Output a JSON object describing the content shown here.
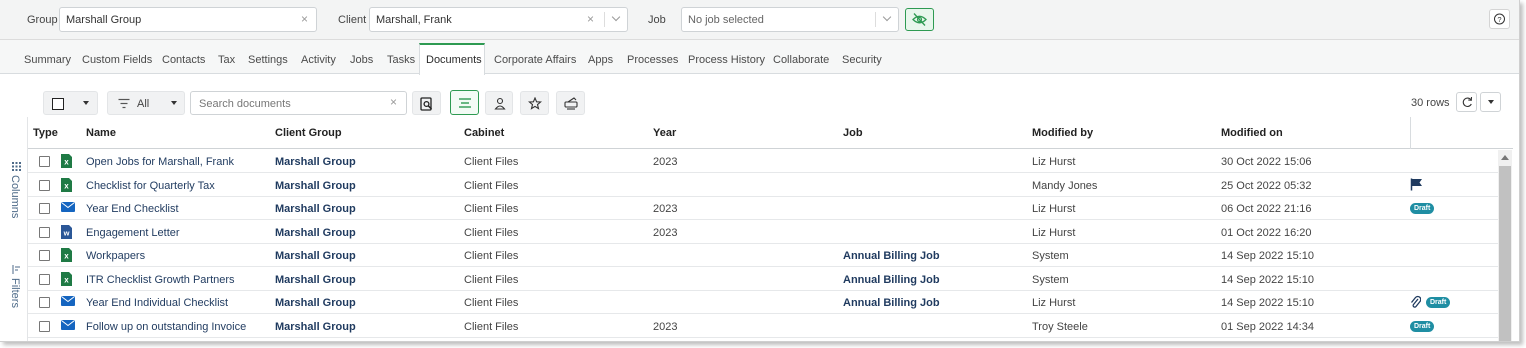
{
  "colors": {
    "accent": "#2e9a52",
    "link": "#1f3a5f",
    "badge": "#1f8ea3",
    "excel": "#1f7a45",
    "word": "#2b5797",
    "mail": "#1565c0"
  },
  "filters": {
    "group_label": "Group",
    "group_value": "Marshall Group",
    "client_label": "Client",
    "client_value": "Marshall, Frank",
    "job_label": "Job",
    "job_placeholder": "No job selected",
    "clear_glyph": "×",
    "help_glyph": "?"
  },
  "tabs": [
    "Summary",
    "Custom Fields",
    "Contacts",
    "Tax",
    "Settings",
    "Activity",
    "Jobs",
    "Tasks",
    "Documents",
    "Corporate Affairs",
    "Apps",
    "Processes",
    "Process History",
    "Collaborate",
    "Security"
  ],
  "active_tab": "Documents",
  "toolbar": {
    "filter_label": "All",
    "search_placeholder": "Search documents",
    "rows_count": "30 rows"
  },
  "rail": {
    "columns_label": "Columns",
    "filters_label": "Filters"
  },
  "table": {
    "headers": [
      "Type",
      "Name",
      "Client Group",
      "Cabinet",
      "Year",
      "Job",
      "Modified by",
      "Modified on"
    ],
    "rows": [
      {
        "type": "excel-icon",
        "name": "Open Jobs for Marshall, Frank",
        "client_group": "Marshall Group",
        "cabinet": "Client Files",
        "year": "2023",
        "job": "",
        "modified_by": "Liz Hurst",
        "modified_on": "30 Oct 2022 15:06",
        "flags": []
      },
      {
        "type": "excel-icon",
        "name": "Checklist for Quarterly Tax",
        "client_group": "Marshall Group",
        "cabinet": "Client Files",
        "year": "",
        "job": "",
        "modified_by": "Mandy Jones",
        "modified_on": "25 Oct 2022 05:32",
        "flags": [
          "flag-icon"
        ]
      },
      {
        "type": "mail-icon",
        "name": "Year End Checklist",
        "client_group": "Marshall Group",
        "cabinet": "Client Files",
        "year": "2023",
        "job": "",
        "modified_by": "Liz Hurst",
        "modified_on": "06 Oct 2022 21:16",
        "flags": [
          "Draft"
        ]
      },
      {
        "type": "word-icon",
        "name": "Engagement Letter",
        "client_group": "Marshall Group",
        "cabinet": "Client Files",
        "year": "2023",
        "job": "",
        "modified_by": "Liz Hurst",
        "modified_on": "01 Oct 2022 16:20",
        "flags": []
      },
      {
        "type": "excel-icon",
        "name": "Workpapers",
        "client_group": "Marshall Group",
        "cabinet": "Client Files",
        "year": "",
        "job": "Annual Billing Job",
        "modified_by": "System",
        "modified_on": "14 Sep 2022 15:10",
        "flags": []
      },
      {
        "type": "excel-icon",
        "name": "ITR Checklist Growth Partners",
        "client_group": "Marshall Group",
        "cabinet": "Client Files",
        "year": "",
        "job": "Annual Billing Job",
        "modified_by": "System",
        "modified_on": "14 Sep 2022 15:10",
        "flags": []
      },
      {
        "type": "mail-icon",
        "name": "Year End Individual Checklist",
        "client_group": "Marshall Group",
        "cabinet": "Client Files",
        "year": "",
        "job": "Annual Billing Job",
        "modified_by": "Liz Hurst",
        "modified_on": "14 Sep 2022 15:10",
        "flags": [
          "paperclip-icon",
          "Draft"
        ]
      },
      {
        "type": "mail-icon",
        "name": "Follow up on outstanding Invoice",
        "client_group": "Marshall Group",
        "cabinet": "Client Files",
        "year": "2023",
        "job": "",
        "modified_by": "Troy Steele",
        "modified_on": "01 Sep 2022 14:34",
        "flags": [
          "Draft"
        ]
      }
    ]
  }
}
